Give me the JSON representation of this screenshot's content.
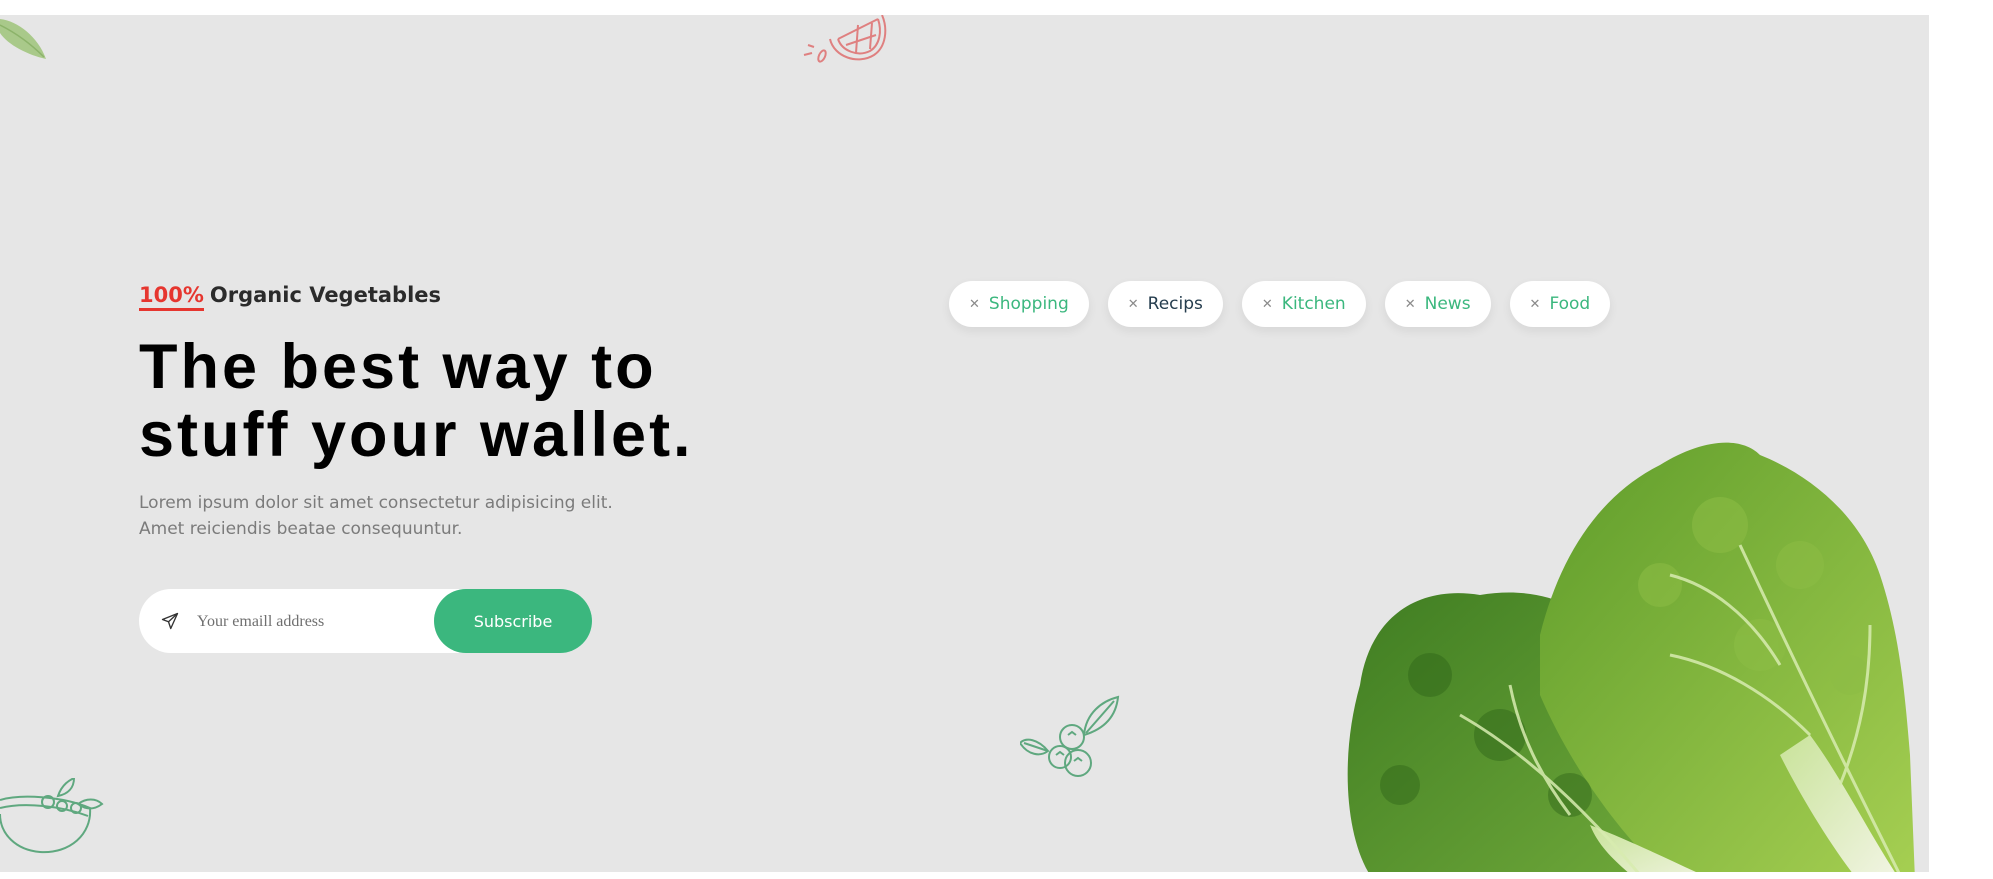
{
  "hero": {
    "eyebrow": {
      "percent": "100%",
      "text": "Organic Vegetables"
    },
    "headline": "The best way to stuff your wallet.",
    "description": "Lorem ipsum dolor sit amet consectetur adipisicing elit. Amet reiciendis beatae consequuntur.",
    "subscribe": {
      "placeholder": "Your emaill address",
      "value": "",
      "button_label": "Subscribe"
    }
  },
  "tags": [
    {
      "label": "Shopping",
      "color": "#3bb77e"
    },
    {
      "label": "Recips",
      "color": "#253d4e"
    },
    {
      "label": "Kitchen",
      "color": "#3bb77e"
    },
    {
      "label": "News",
      "color": "#3bb77e"
    },
    {
      "label": "Food",
      "color": "#3bb77e"
    }
  ],
  "icons": {
    "send": "paper-plane-icon",
    "tag_remove": "close-icon",
    "decorations": [
      "leaf-icon",
      "orange-slice-icon",
      "berries-icon",
      "salad-bowl-icon",
      "lettuce-image"
    ]
  },
  "colors": {
    "accent_green": "#3bb77e",
    "accent_red": "#e6362f",
    "hero_background": "#e6e6e6",
    "dark_text": "#253d4e"
  }
}
